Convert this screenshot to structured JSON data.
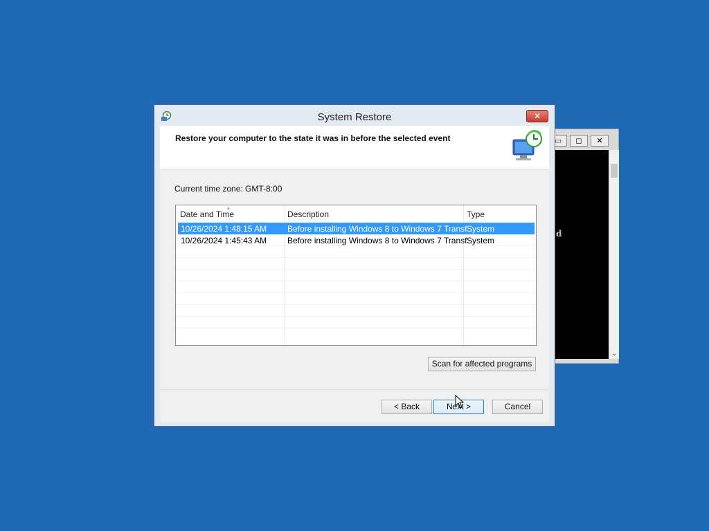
{
  "console": {
    "glyph": "d"
  },
  "dialog": {
    "title": "System Restore",
    "close_label": "✕",
    "heading": "Restore your computer to the state it was in before the selected event",
    "timezone": "Current time zone: GMT-8:00",
    "columns": [
      "Date and Time",
      "Description",
      "Type"
    ],
    "rows": [
      {
        "date": "10/26/2024 1:48:15 AM",
        "description": "Before installing Windows 8 to Windows 7 Transf…",
        "type": "System",
        "selected": true
      },
      {
        "date": "10/26/2024 1:45:43 AM",
        "description": "Before installing Windows 8 to Windows 7 Transf…",
        "type": "System",
        "selected": false
      }
    ],
    "buttons": {
      "scan": "Scan for affected programs",
      "back": "< Back",
      "next": "Next >",
      "cancel": "Cancel"
    }
  },
  "colors": {
    "desktop": "#1f69b4",
    "selection": "#3399ff"
  }
}
